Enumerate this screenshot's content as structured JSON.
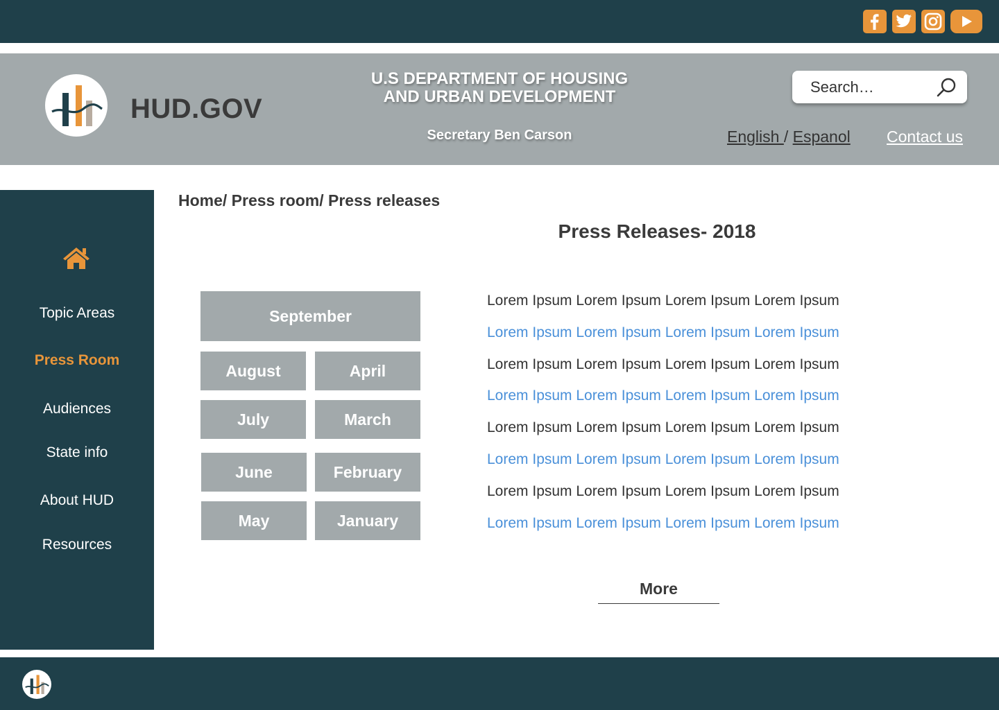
{
  "social": {
    "icons": [
      "facebook-icon",
      "twitter-icon",
      "instagram-icon",
      "youtube-icon"
    ],
    "accent": "#e8953a"
  },
  "header": {
    "site_name": "HUD.GOV",
    "dept_line1": "U.S DEPARTMENT OF HOUSING",
    "dept_line2": "AND URBAN DEVELOPMENT",
    "secretary": "Secretary Ben Carson",
    "search_placeholder": "Search…",
    "lang_english": "English ",
    "lang_sep": "/ ",
    "lang_espanol": "Espanol",
    "contact": "Contact us"
  },
  "sidebar": {
    "items": [
      {
        "label": "Topic Areas"
      },
      {
        "label": "Press Room"
      },
      {
        "label": "Audiences"
      },
      {
        "label": "State info"
      },
      {
        "label": "About HUD"
      },
      {
        "label": "Resources"
      }
    ],
    "active": "Press Room"
  },
  "main": {
    "breadcrumb": "Home/ Press room/ Press releases",
    "title": "Press Releases- 2018",
    "months": {
      "september": "September",
      "august": "August",
      "april": "April",
      "july": "July",
      "march": "March",
      "june": "June",
      "february": "February",
      "may": "May",
      "january": "January"
    },
    "releases": [
      "Lorem Ipsum Lorem Ipsum Lorem Ipsum Lorem Ipsum",
      "Lorem Ipsum Lorem Ipsum Lorem Ipsum Lorem Ipsum",
      "Lorem Ipsum Lorem Ipsum Lorem Ipsum Lorem Ipsum",
      "Lorem Ipsum Lorem Ipsum Lorem Ipsum Lorem Ipsum",
      "Lorem Ipsum Lorem Ipsum Lorem Ipsum Lorem Ipsum",
      "Lorem Ipsum Lorem Ipsum Lorem Ipsum Lorem Ipsum",
      "Lorem Ipsum Lorem Ipsum Lorem Ipsum Lorem Ipsum",
      "Lorem Ipsum Lorem Ipsum Lorem Ipsum Lorem Ipsum"
    ],
    "more": "More"
  },
  "colors": {
    "dark_teal": "#1f404a",
    "gray": "#a2a9ab",
    "orange": "#e8953a",
    "link_blue": "#4a90d9"
  }
}
